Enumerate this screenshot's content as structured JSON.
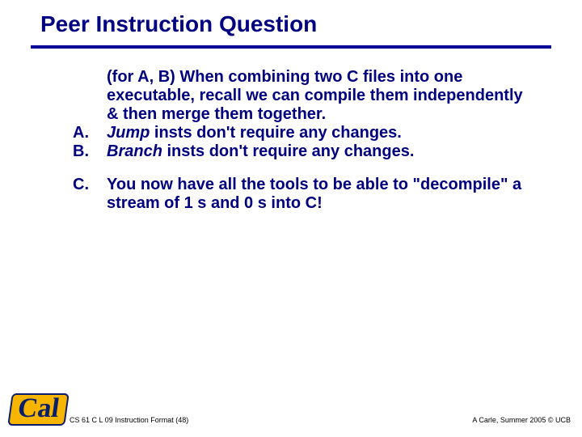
{
  "title": "Peer Instruction Question",
  "intro": "(for A, B) When combining two C files into one executable, recall we can compile them independently & then merge them together.",
  "items": [
    {
      "label": "A.",
      "strong": "Jump",
      "rest": " insts don't require any changes."
    },
    {
      "label": "B.",
      "strong": "Branch",
      "rest": " insts don't require any changes."
    }
  ],
  "item_c": {
    "label": "C.",
    "text": "You now have all the tools to be able to \"decompile\" a stream of 1 s and 0 s into C!"
  },
  "logo_text": "Cal",
  "footer_left": "CS 61 C L 09 Instruction Format (48)",
  "footer_right": "A Carle, Summer 2005 © UCB"
}
